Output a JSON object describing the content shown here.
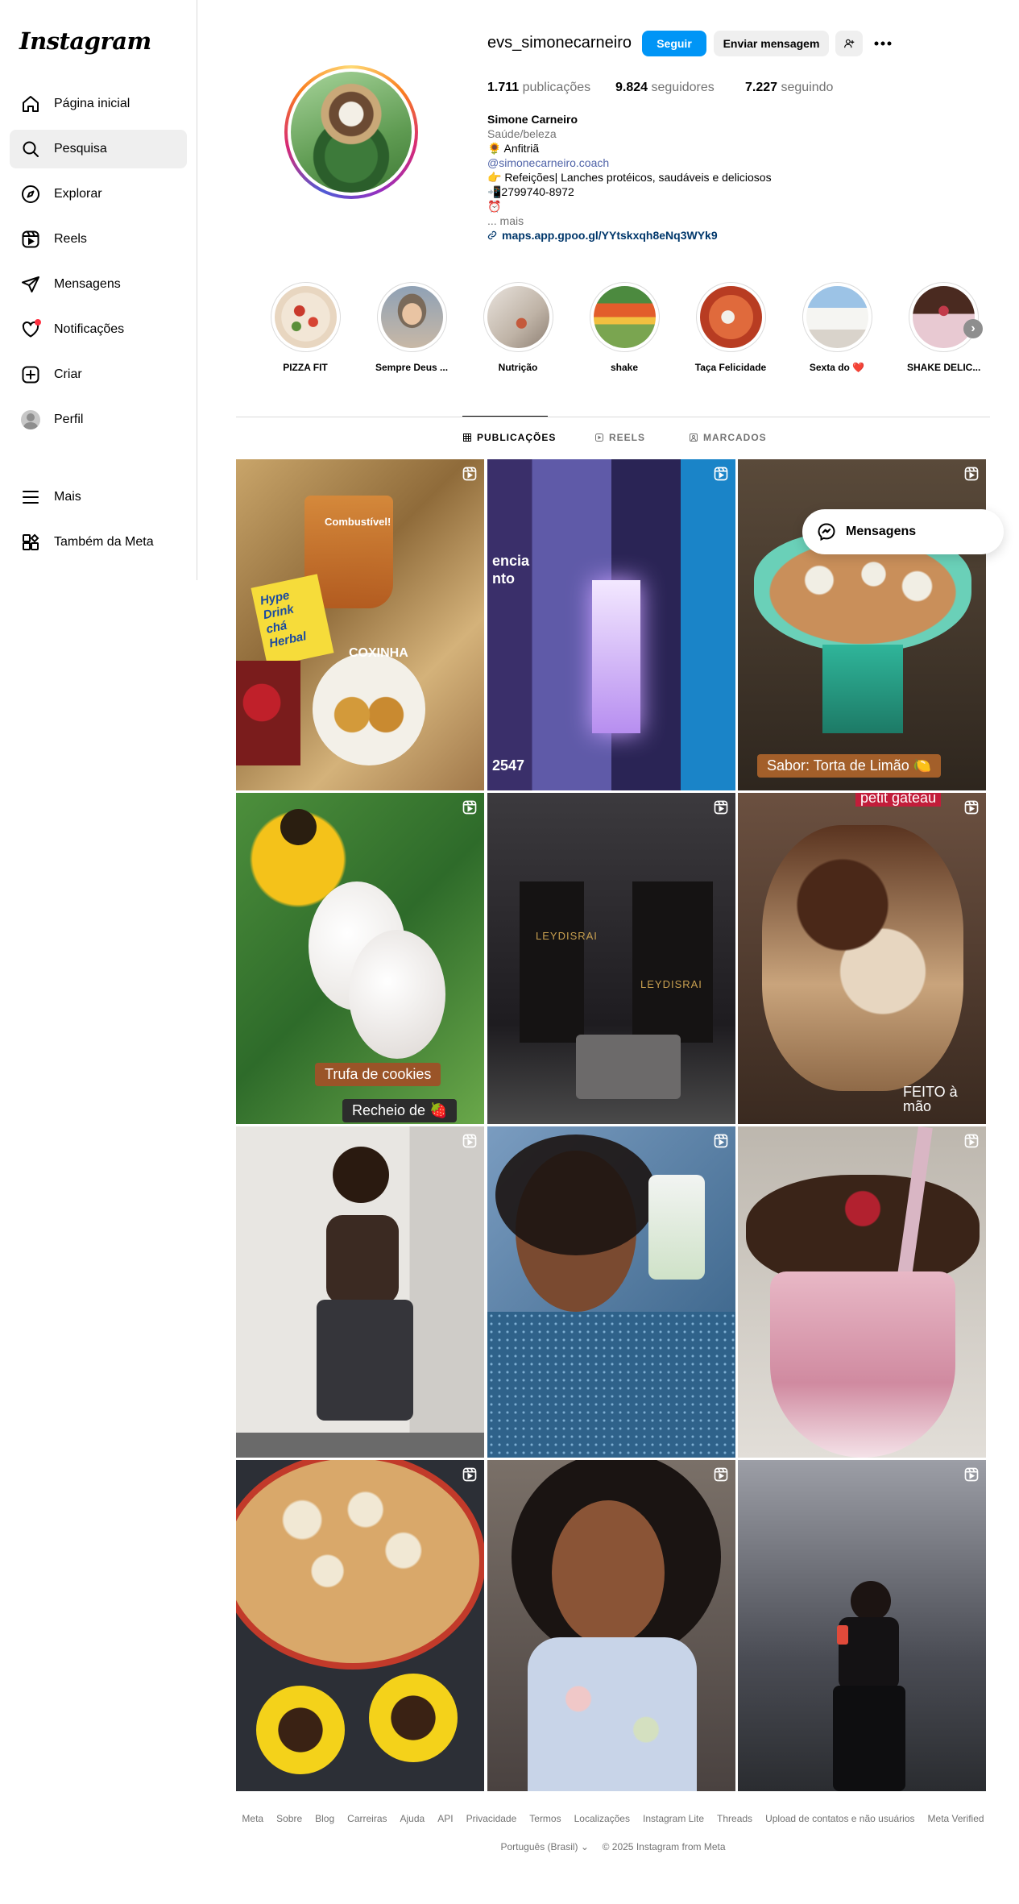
{
  "app": {
    "logo": "Instagram"
  },
  "sidebar": {
    "items": [
      {
        "label": "Página inicial",
        "icon": "home-icon"
      },
      {
        "label": "Pesquisa",
        "icon": "search-icon",
        "active": true
      },
      {
        "label": "Explorar",
        "icon": "compass-icon"
      },
      {
        "label": "Reels",
        "icon": "reels-icon"
      },
      {
        "label": "Mensagens",
        "icon": "send-icon"
      },
      {
        "label": "Notificações",
        "icon": "heart-icon"
      },
      {
        "label": "Criar",
        "icon": "plus-square-icon"
      },
      {
        "label": "Perfil",
        "icon": "avatar"
      },
      {
        "label": "Mais",
        "icon": "menu-icon"
      },
      {
        "label": "Também da Meta",
        "icon": "meta-apps-icon"
      }
    ]
  },
  "profile": {
    "username": "evs_simonecarneiro",
    "follow_label": "Seguir",
    "message_label": "Enviar mensagem",
    "stats": {
      "posts_count": "1.711",
      "posts_label": "publicações",
      "followers_count": "9.824",
      "followers_label": "seguidores",
      "following_count": "7.227",
      "following_label": "seguindo"
    },
    "name": "Simone Carneiro",
    "category": "Saúde/beleza",
    "bio": {
      "line1": "🌻 Anfitriã",
      "handle": "@simonecarneiro.coach",
      "line3": "👉 Refeições| Lanches protéicos, saudáveis e deliciosos",
      "line4": "📲2799740-8972",
      "line5": "⏰",
      "more": "... mais",
      "url": "maps.app.gpoo.gl/YYtskxqh8eNq3WYk9"
    }
  },
  "highlights": [
    {
      "label": "PIZZA FIT"
    },
    {
      "label": "Sempre Deus ..."
    },
    {
      "label": "Nutrição"
    },
    {
      "label": "shake"
    },
    {
      "label": "Taça Felicidade"
    },
    {
      "label": "Sexta do ❤️"
    },
    {
      "label": "SHAKE DELIC..."
    }
  ],
  "tabs": [
    {
      "label": "PUBLICAÇÕES",
      "active": true
    },
    {
      "label": "REELS"
    },
    {
      "label": "MARCADOS"
    }
  ],
  "posts": {
    "p1_text_a": "Combustível!",
    "p1_text_b": "Hype Drink chá Herbal",
    "p1_text_c": "COXINHA",
    "p2_text_a": "encia nto",
    "p2_text_b": "2547",
    "p3_caption": "Sabor: Torta de Limão 🍋",
    "p4_caption_a": "Trufa de cookies",
    "p4_caption_b": "Recheio de 🍓",
    "p5_text": "LEYDISRAI",
    "p6_text_a": "petit gateau",
    "p6_text_b": "FEITO à mão"
  },
  "messages_float": {
    "label": "Mensagens"
  },
  "footer": {
    "links": [
      "Meta",
      "Sobre",
      "Blog",
      "Carreiras",
      "Ajuda",
      "API",
      "Privacidade",
      "Termos",
      "Localizações",
      "Instagram Lite",
      "Threads",
      "Upload de contatos e não usuários",
      "Meta Verified"
    ],
    "language": "Português (Brasil)",
    "copyright": "© 2025 Instagram from Meta"
  }
}
